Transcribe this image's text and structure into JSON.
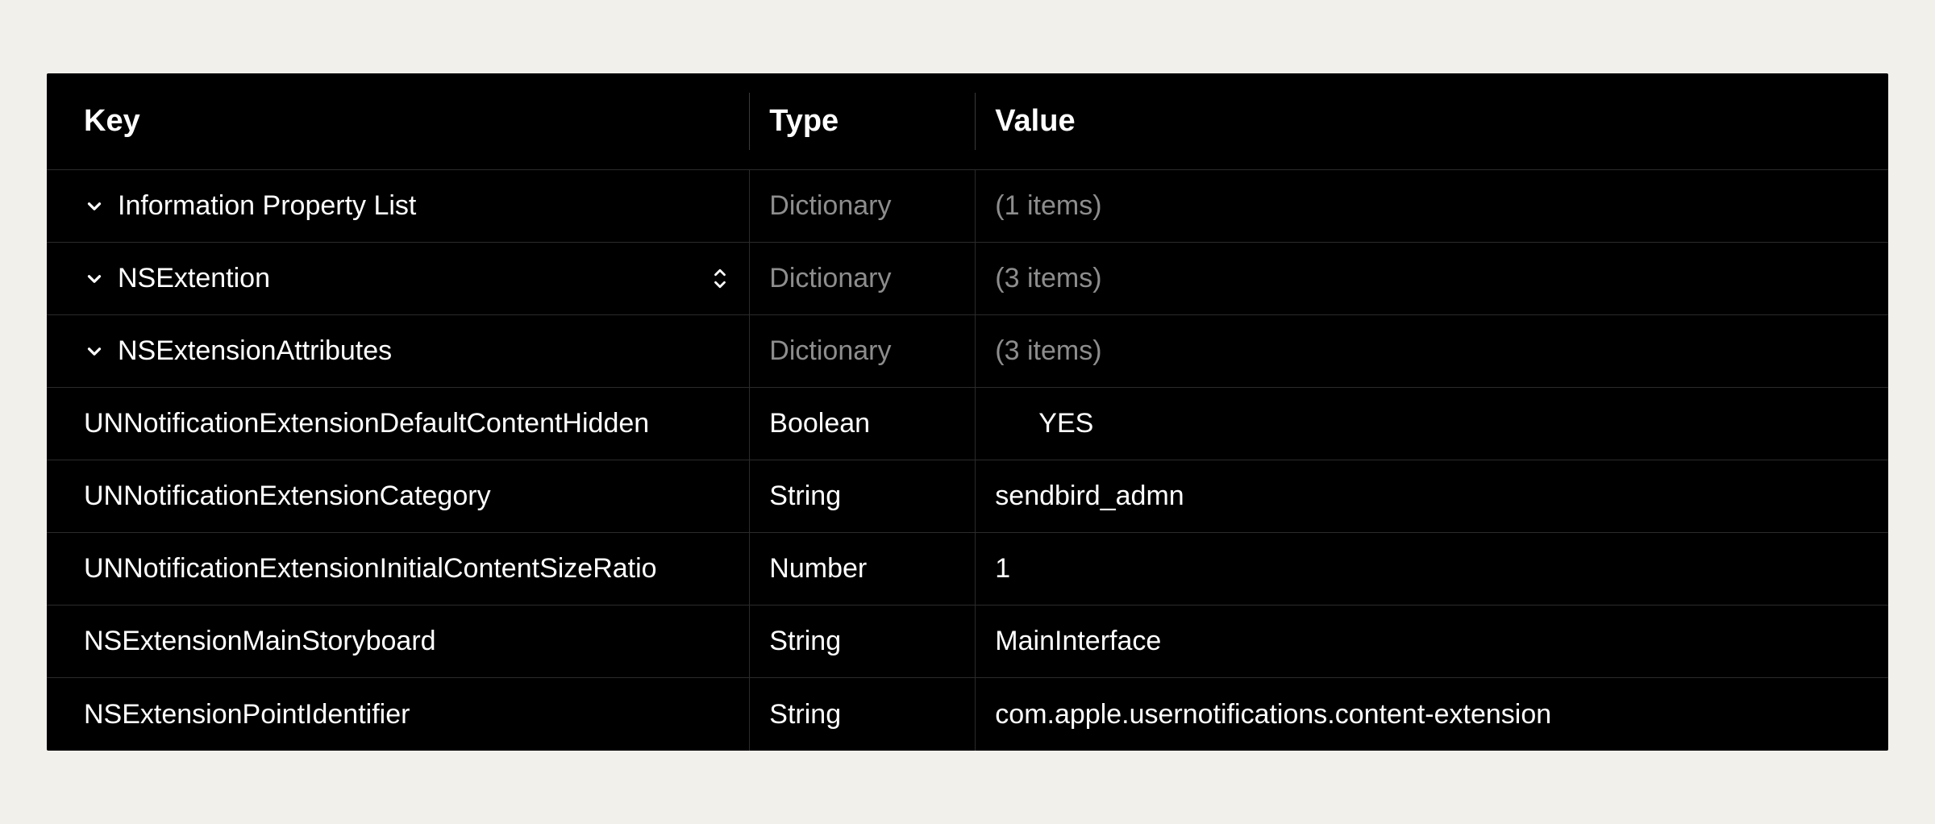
{
  "columns": {
    "key": "Key",
    "type": "Type",
    "value": "Value"
  },
  "rows": [
    {
      "indent": 0,
      "chevron": true,
      "key": "Information Property List",
      "type": "Dictionary",
      "type_muted": true,
      "value": "(1 items)",
      "value_muted": true,
      "updown": false
    },
    {
      "indent": 1,
      "chevron": true,
      "key": "NSExtention",
      "type": "Dictionary",
      "type_muted": true,
      "value": "(3 items)",
      "value_muted": true,
      "updown": true
    },
    {
      "indent": 2,
      "chevron": true,
      "key": "NSExtensionAttributes",
      "type": "Dictionary",
      "type_muted": true,
      "value": "(3 items)",
      "value_muted": true,
      "updown": false
    },
    {
      "indent": 3,
      "chevron": false,
      "key": "UNNotificationExtensionDefaultContentHidden",
      "type": "Boolean",
      "type_muted": false,
      "value": "YES",
      "value_muted": false,
      "value_pad": true,
      "updown": false
    },
    {
      "indent": 3,
      "chevron": false,
      "key": "UNNotificationExtensionCategory",
      "type": "String",
      "type_muted": false,
      "value": "sendbird_admn",
      "value_muted": false,
      "updown": false
    },
    {
      "indent": 3,
      "chevron": false,
      "key": "UNNotificationExtensionInitialContentSizeRatio",
      "type": "Number",
      "type_muted": false,
      "value": "1",
      "value_muted": false,
      "updown": false
    },
    {
      "indent": 2,
      "chevron": false,
      "key": "NSExtensionMainStoryboard",
      "type": "String",
      "type_muted": false,
      "value": "MainInterface",
      "value_muted": false,
      "updown": false
    },
    {
      "indent": 2,
      "chevron": false,
      "key": "NSExtensionPointIdentifier",
      "type": "String",
      "type_muted": false,
      "value": "com.apple.usernotifications.content-extension",
      "value_muted": false,
      "updown": false
    }
  ]
}
